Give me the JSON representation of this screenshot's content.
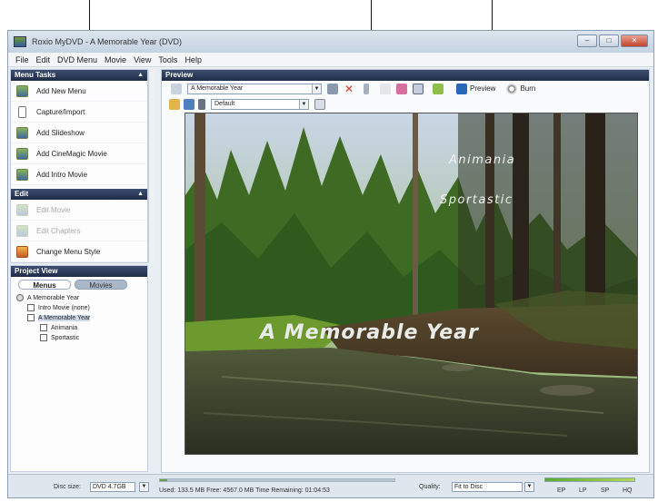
{
  "window": {
    "title": "Roxio MyDVD - A Memorable Year (DVD)",
    "controls": {
      "minimize": "–",
      "maximize": "□",
      "close": "✕"
    }
  },
  "menubar": [
    "File",
    "Edit",
    "DVD Menu",
    "Movie",
    "View",
    "Tools",
    "Help"
  ],
  "menu_tasks": {
    "header": "Menu Tasks",
    "items": [
      {
        "label": "Add New Menu",
        "icon": "add-menu-icon"
      },
      {
        "label": "Capture/Import",
        "icon": "capture-icon"
      },
      {
        "label": "Add Slideshow",
        "icon": "slideshow-icon"
      },
      {
        "label": "Add CineMagic Movie",
        "icon": "cinemagic-icon"
      },
      {
        "label": "Add Intro Movie",
        "icon": "intro-movie-icon"
      }
    ]
  },
  "edit": {
    "header": "Edit",
    "items": [
      {
        "label": "Edit Movie",
        "disabled": true
      },
      {
        "label": "Edit Chapters",
        "disabled": true
      },
      {
        "label": "Change Menu Style",
        "disabled": false
      }
    ]
  },
  "project_view": {
    "header": "Project View",
    "tabs": [
      "Menus",
      "Movies"
    ],
    "tree": [
      {
        "label": "A Memorable Year",
        "level": 0
      },
      {
        "label": "Intro Movie (none)",
        "level": 1
      },
      {
        "label": "A Memorable Year",
        "level": 1,
        "selected": true
      },
      {
        "label": "Animania",
        "level": 2
      },
      {
        "label": "Sportastic",
        "level": 2
      }
    ]
  },
  "preview": {
    "header": "Preview",
    "menu_select": "A Memorable Year",
    "theme_select": "Default",
    "preview_label": "Preview",
    "burn_label": "Burn",
    "title_text": "A Memorable Year",
    "buttons": [
      "Animania",
      "Sportastic"
    ]
  },
  "statusbar": {
    "disc_size_label": "Disc size:",
    "disc_size_value": "DVD 4.7GB",
    "usage_text": "Used: 133.5 MB  Free: 4567.0 MB  Time Remaining: 01:04:53",
    "usage_fraction": 0.03,
    "quality_label": "Quality:",
    "quality_value": "Fit to Disc",
    "quality_scale": [
      "EP",
      "LP",
      "SP",
      "HQ"
    ]
  }
}
